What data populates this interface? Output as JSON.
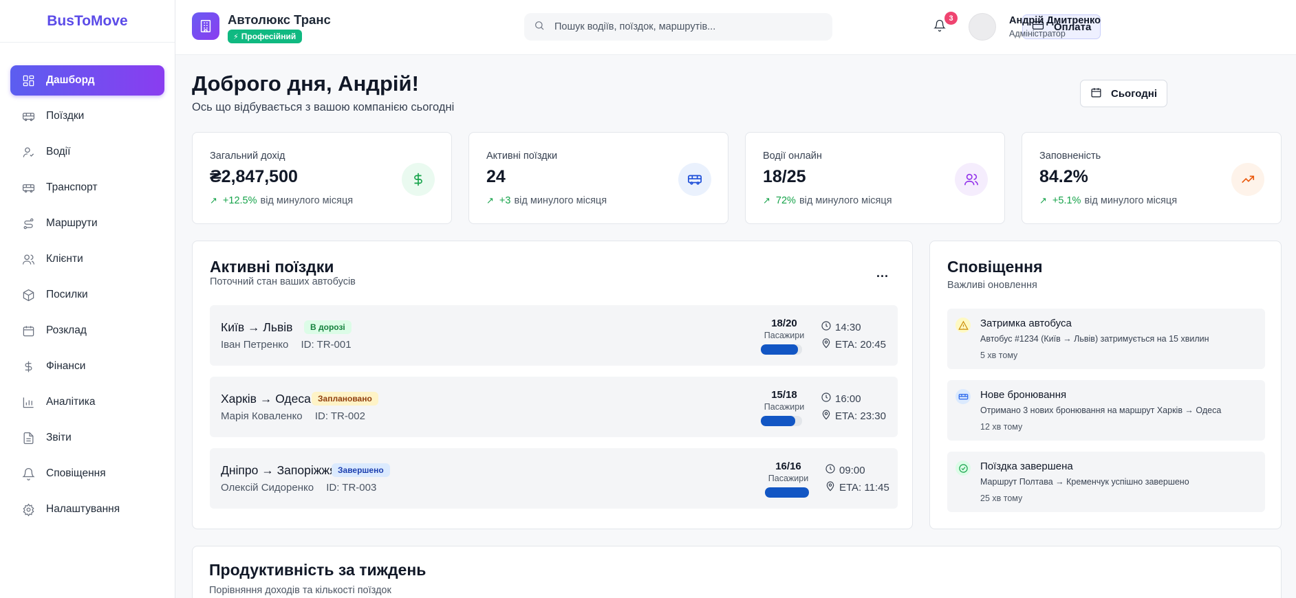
{
  "sidebar": {
    "brand": "BusToMove",
    "items": [
      {
        "label": "Дашборд",
        "icon": "dashboard-icon"
      },
      {
        "label": "Поїздки",
        "icon": "bus-icon"
      },
      {
        "label": "Водії",
        "icon": "user-check-icon"
      },
      {
        "label": "Транспорт",
        "icon": "bus-icon"
      },
      {
        "label": "Маршрути",
        "icon": "route-icon"
      },
      {
        "label": "Клієнти",
        "icon": "users-icon"
      },
      {
        "label": "Посилки",
        "icon": "package-icon"
      },
      {
        "label": "Розклад",
        "icon": "calendar-icon"
      },
      {
        "label": "Фінанси",
        "icon": "dollar-icon"
      },
      {
        "label": "Аналітика",
        "icon": "chart-icon"
      },
      {
        "label": "Звіти",
        "icon": "file-icon"
      },
      {
        "label": "Сповіщення",
        "icon": "bell-icon"
      },
      {
        "label": "Налаштування",
        "icon": "gear-icon"
      }
    ]
  },
  "header": {
    "company_name": "Автолюкс Транс",
    "plan": "Професійний",
    "search_placeholder": "Пошук водіїв, поїздок, маршрутів...",
    "pay_label": "Оплата",
    "notification_count": "3",
    "user_name": "Андрій Дмитренко",
    "user_role": "Адміністратор"
  },
  "main": {
    "greeting": "Доброго дня, Андрій!",
    "subtitle": "Ось що відбувається з вашою компанією сьогодні",
    "today_label": "Сьогодні"
  },
  "stats": [
    {
      "label": "Загальний дохід",
      "value": "₴2,847,500",
      "delta": "+12.5%",
      "suffix": "від минулого місяця",
      "icon": "dollar-icon",
      "icon_color": "#16a34a",
      "icon_bg": "#eafaf0"
    },
    {
      "label": "Активні поїздки",
      "value": "24",
      "delta": "+3",
      "suffix": "від минулого місяця",
      "icon": "bus-icon",
      "icon_color": "#1d4ed8",
      "icon_bg": "#eaf1fd"
    },
    {
      "label": "Водії онлайн",
      "value": "18/25",
      "delta": "72%",
      "suffix": "від минулого місяця",
      "icon": "users-icon",
      "icon_color": "#9333ea",
      "icon_bg": "#f5edfd"
    },
    {
      "label": "Заповненість",
      "value": "84.2%",
      "delta": "+5.1%",
      "suffix": "від минулого місяця",
      "icon": "trending-up-icon",
      "icon_color": "#ea580c",
      "icon_bg": "#fef3ea"
    }
  ],
  "active_trips": {
    "title": "Активні поїздки",
    "subtitle": "Поточний стан ваших автобусів",
    "more": "...",
    "passengers_label": "Пасажири",
    "trips": [
      {
        "route": "Київ → Львів",
        "status": "В дорозі",
        "status_bg": "#dcfce7",
        "status_color": "#15803d",
        "driver": "Іван Петренко",
        "id": "ID: TR-001",
        "passengers": "18/20",
        "fill": 0.9,
        "time": "14:30",
        "eta": "ETA: 20:45"
      },
      {
        "route": "Харків → Одеса",
        "status": "Заплановано",
        "status_bg": "#fef3c7",
        "status_color": "#92400e",
        "driver": "Марія Коваленко",
        "id": "ID: TR-002",
        "passengers": "15/18",
        "fill": 0.833,
        "time": "16:00",
        "eta": "ETA: 23:30"
      },
      {
        "route": "Дніпро → Запоріжжя",
        "status": "Завершено",
        "status_bg": "#dbeafe",
        "status_color": "#1e40af",
        "driver": "Олексій Сидоренко",
        "id": "ID: TR-003",
        "passengers": "16/16",
        "fill": 1.0,
        "time": "09:00",
        "eta": "ETA: 11:45"
      }
    ]
  },
  "notifications": {
    "title": "Сповіщення",
    "subtitle": "Важливі оновлення",
    "items": [
      {
        "title": "Затримка автобуса",
        "text": "Автобус #1234 (Київ → Львів) затримується на 15 хвилин",
        "time": "5 хв тому",
        "icon": "warning-icon",
        "icon_color": "#ca8a04",
        "icon_bg": "#fef9c3"
      },
      {
        "title": "Нове бронювання",
        "text": "Отримано 3 нових бронювання на маршрут Харків → Одеса",
        "time": "12 хв тому",
        "icon": "bus-icon",
        "icon_color": "#2563eb",
        "icon_bg": "#dbeafe"
      },
      {
        "title": "Поїздка завершена",
        "text": "Маршрут Полтава → Кременчук успішно завершено",
        "time": "25 хв тому",
        "icon": "check-circle-icon",
        "icon_color": "#16a34a",
        "icon_bg": "#dcfce7"
      }
    ]
  },
  "performance": {
    "title": "Продуктивність за тиждень",
    "subtitle": "Порівняння доходів та кількості поїздок"
  }
}
